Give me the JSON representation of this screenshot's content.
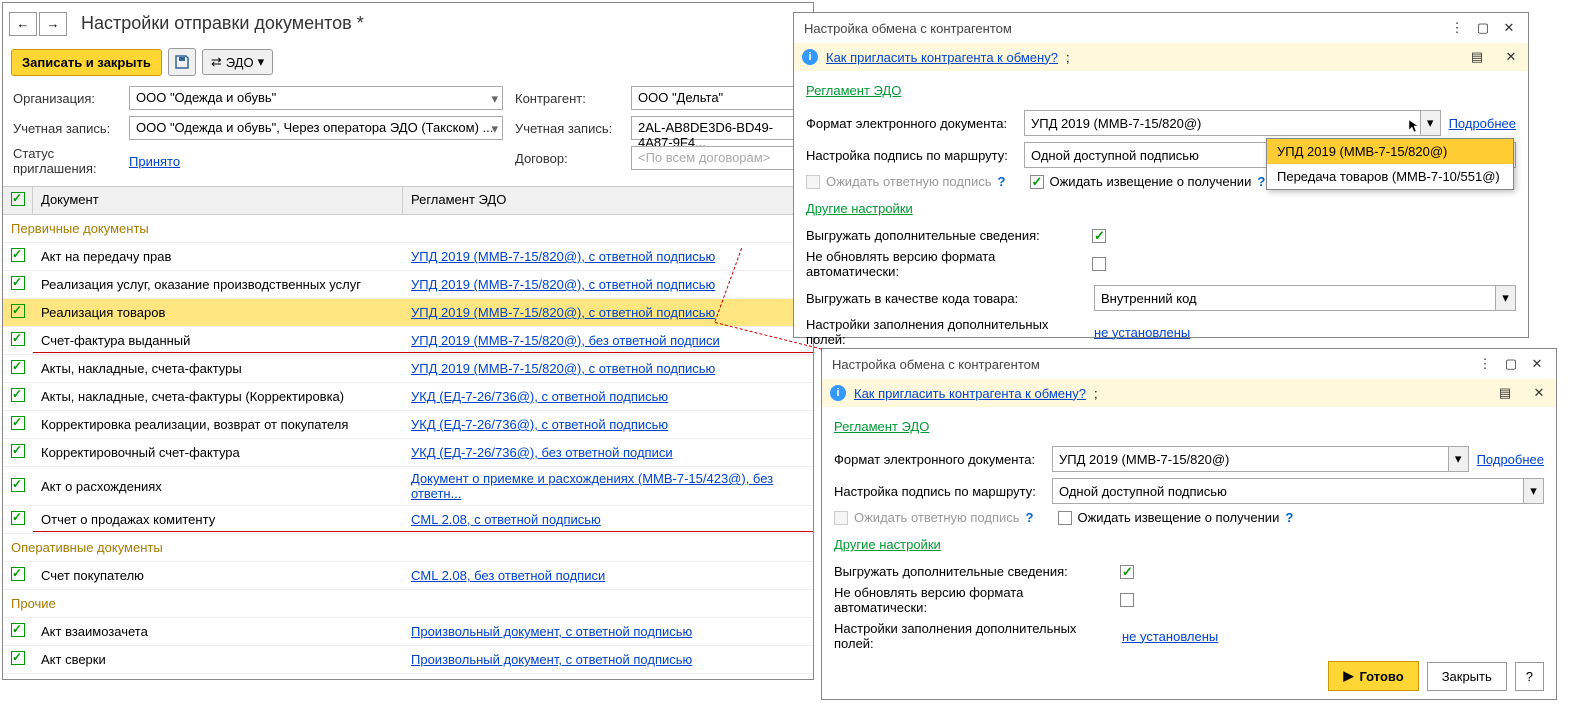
{
  "main": {
    "title": "Настройки отправки документов *",
    "saveAndClose": "Записать и закрыть",
    "edoBtn": "ЭДО",
    "fields": {
      "org": {
        "label": "Организация:",
        "value": "ООО \"Одежда и обувь\""
      },
      "acct": {
        "label": "Учетная запись:",
        "value": "ООО \"Одежда и обувь\", Через оператора ЭДО (Такском) ..."
      },
      "status": {
        "label": "Статус приглашения:",
        "value": "Принято"
      },
      "counter": {
        "label": "Контрагент:",
        "value": "ООО \"Дельта\""
      },
      "acct2": {
        "label": "Учетная запись:",
        "value": "2AL-AB8DE3D6-BD49-4A87-9F4..."
      },
      "contract": {
        "label": "Договор:",
        "placeholder": "<По всем договорам>"
      }
    },
    "columns": {
      "doc": "Документ",
      "reg": "Регламент ЭДО"
    },
    "groups": [
      {
        "title": "Первичные документы",
        "rows": [
          {
            "doc": "Акт на передачу прав",
            "reg": "УПД 2019 (ММВ-7-15/820@), с ответной подписью"
          },
          {
            "doc": "Реализация услуг, оказание производственных услуг",
            "reg": "УПД 2019 (ММВ-7-15/820@), с ответной подписью"
          },
          {
            "doc": "Реализация товаров",
            "reg": "УПД 2019 (ММВ-7-15/820@), с ответной подписью",
            "selected": true
          },
          {
            "doc": "Счет-фактура выданный",
            "reg": "УПД 2019 (ММВ-7-15/820@), без ответной подписи",
            "underline": true
          },
          {
            "doc": "Акты, накладные, счета-фактуры",
            "reg": "УПД 2019 (ММВ-7-15/820@), с ответной подписью"
          },
          {
            "doc": "Акты, накладные, счета-фактуры (Корректировка)",
            "reg": "УКД (ЕД-7-26/736@), с ответной подписью"
          },
          {
            "doc": "Корректировка реализации, возврат от покупателя",
            "reg": "УКД (ЕД-7-26/736@), с ответной подписью"
          },
          {
            "doc": "Корректировочный счет-фактура",
            "reg": "УКД (ЕД-7-26/736@), без ответной подписи"
          },
          {
            "doc": "Акт о расхождениях",
            "reg": "Документ о приемке и расхождениях (ММВ-7-15/423@), без ответн..."
          },
          {
            "doc": "Отчет о продажах комитенту",
            "reg": "CML 2.08, с ответной подписью",
            "underline": true
          }
        ]
      },
      {
        "title": "Оперативные документы",
        "rows": [
          {
            "doc": "Счет покупателю",
            "reg": "CML 2.08, без ответной подписи"
          }
        ]
      },
      {
        "title": "Прочие",
        "rows": [
          {
            "doc": "Акт взаимозачета",
            "reg": "Произвольный документ, с ответной подписью"
          },
          {
            "doc": "Акт сверки",
            "reg": "Произвольный документ, с ответной подписью"
          }
        ]
      }
    ]
  },
  "dlg": {
    "title": "Настройка обмена с контрагентом",
    "inviteLink": "Как пригласить контрагента к обмену?",
    "inviteSuffix": ";",
    "section1": "Регламент ЭДО",
    "format": {
      "label": "Формат электронного документа:",
      "value": "УПД 2019 (ММВ-7-15/820@)"
    },
    "moreLink": "Подробнее",
    "route": {
      "label": "Настройка подпись по маршруту:",
      "value": "Одной доступной подписью"
    },
    "waitReply": "Ожидать ответную подпись",
    "waitNotice": "Ожидать извещение о получении",
    "section2": "Другие настройки",
    "exportInfo": "Выгружать дополнительные сведения:",
    "noAutoUpdate": "Не обновлять версию формата автоматически:",
    "exportCode": {
      "label": "Выгружать в качестве кода товара:",
      "value": "Внутренний код"
    },
    "fillSettings": {
      "label": "Настройки заполнения дополнительных полей:",
      "value": "не установлены"
    },
    "ddOptions": [
      "УПД 2019 (ММВ-7-15/820@)",
      "Передача товаров (ММВ-7-10/551@)"
    ],
    "footer": {
      "ready": "Готово",
      "close": "Закрыть",
      "q": "?"
    }
  }
}
